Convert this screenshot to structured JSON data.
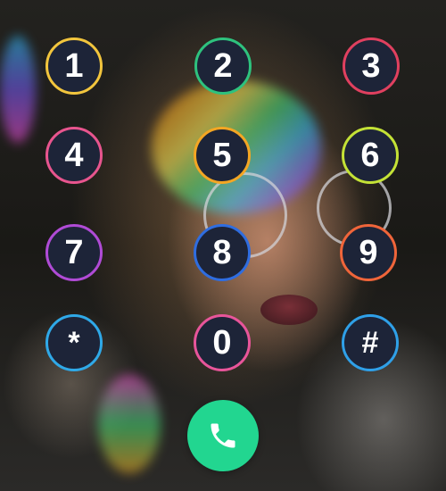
{
  "keypad": {
    "keys": [
      {
        "label": "1",
        "ring_color": "#f2c53d"
      },
      {
        "label": "2",
        "ring_color": "#2ec27e"
      },
      {
        "label": "3",
        "ring_color": "#e0405f"
      },
      {
        "label": "4",
        "ring_color": "#e8558e"
      },
      {
        "label": "5",
        "ring_color": "#f4a623"
      },
      {
        "label": "6",
        "ring_color": "#c4e236"
      },
      {
        "label": "7",
        "ring_color": "#b04bd6"
      },
      {
        "label": "8",
        "ring_color": "#2f6de0"
      },
      {
        "label": "9",
        "ring_color": "#f0653a"
      },
      {
        "label": "*",
        "ring_color": "#2fa9e8"
      },
      {
        "label": "0",
        "ring_color": "#e8559a"
      },
      {
        "label": "#",
        "ring_color": "#2fa0e8"
      }
    ]
  },
  "call": {
    "icon": "phone-icon",
    "color": "#22d690"
  }
}
